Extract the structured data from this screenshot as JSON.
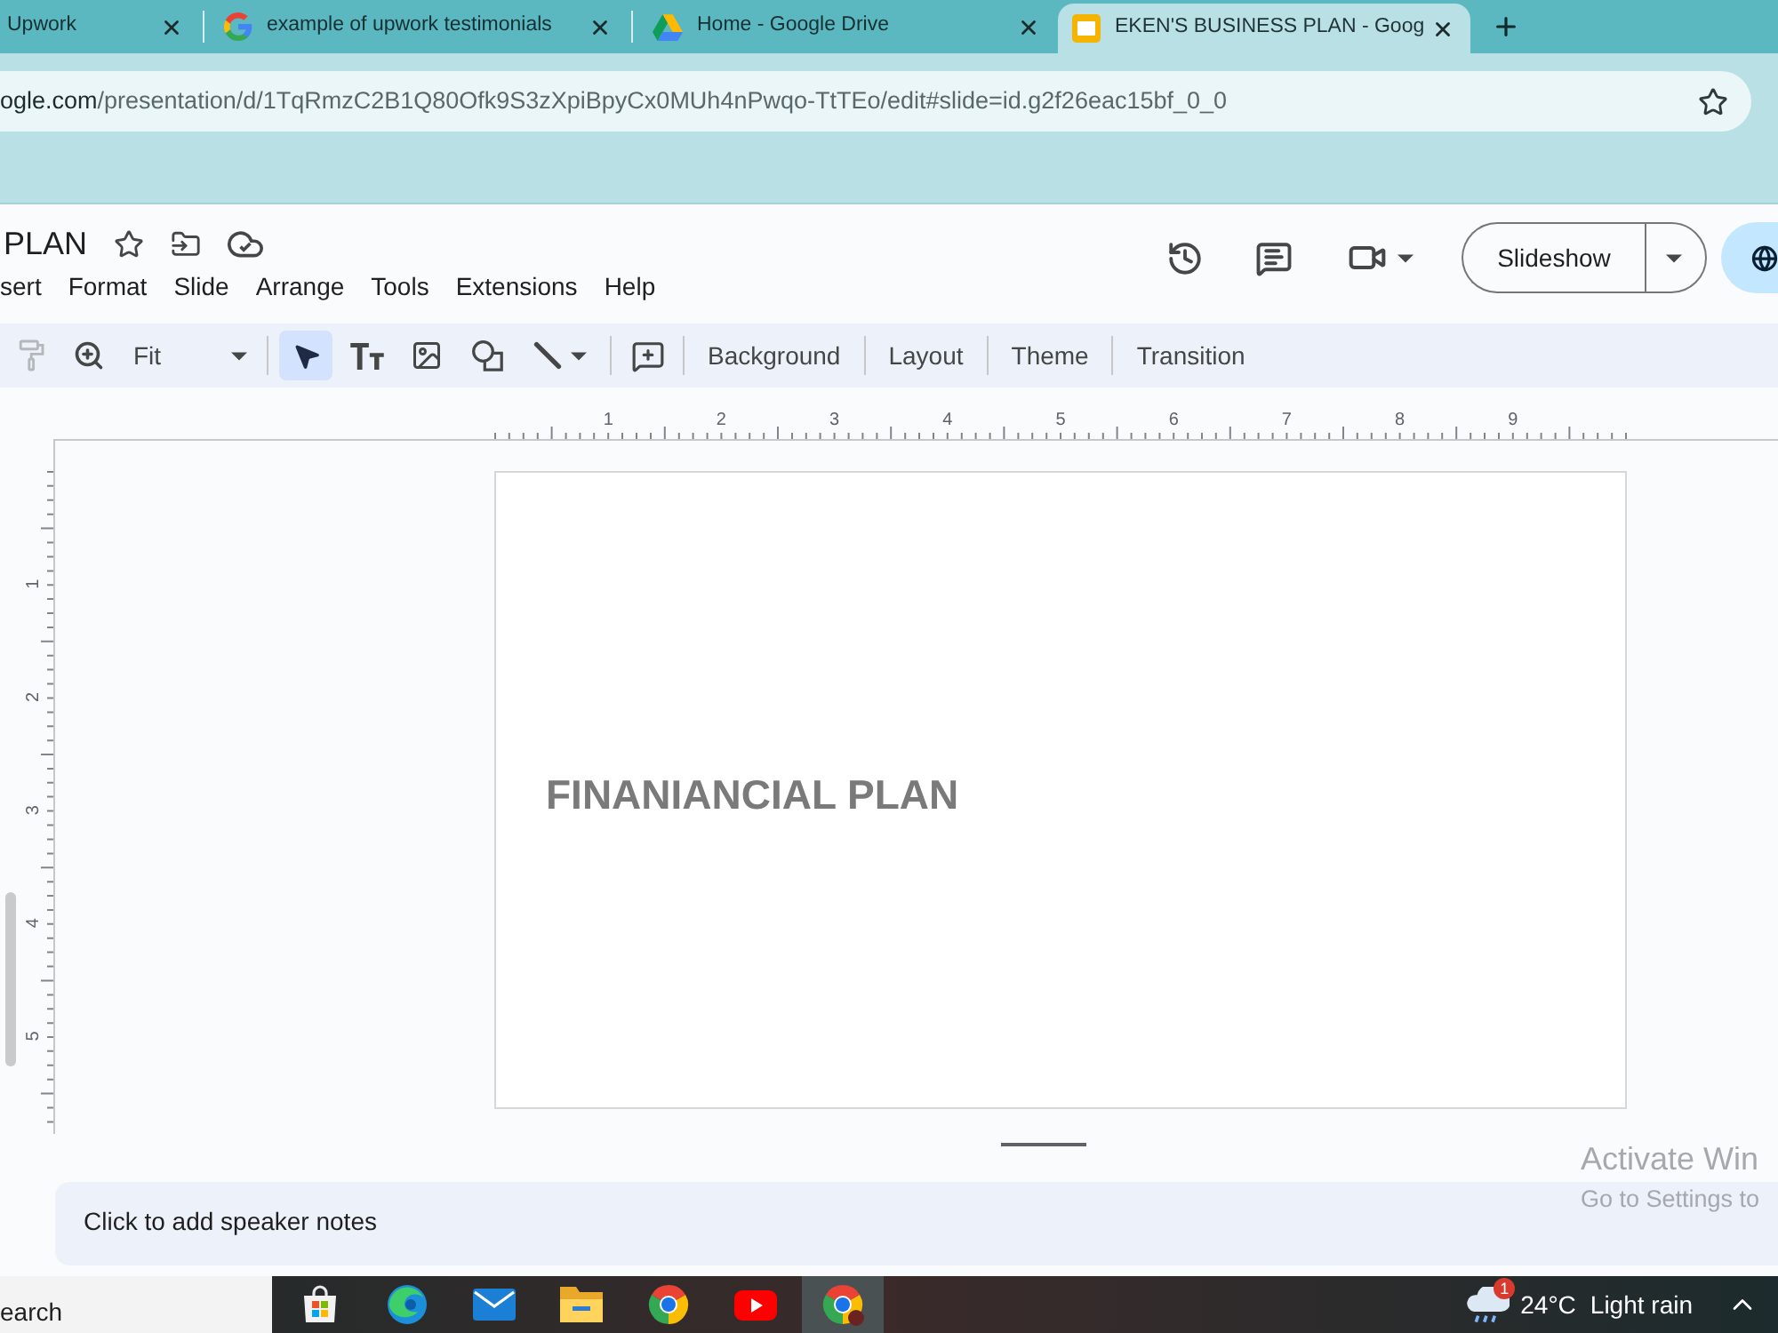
{
  "browser": {
    "tabs": [
      {
        "title": "Upwork",
        "kind": "plain",
        "selected": false
      },
      {
        "title": "example of upwork testimonials",
        "kind": "search",
        "selected": false
      },
      {
        "title": "Home - Google Drive",
        "kind": "drive",
        "selected": false
      },
      {
        "title": "EKEN'S BUSINESS PLAN - Goog",
        "kind": "slides",
        "selected": true
      }
    ],
    "address_bar": {
      "host": "ogle.com",
      "path": "/presentation/d/1TqRmzC2B1Q80Ofk9S3zXpiBpyCx0MUh4nPwqo-TtTEo/edit#slide=id.g2f26eac15bf_0_0"
    }
  },
  "slides_app": {
    "document_title": "PLAN",
    "menu": [
      "sert",
      "Format",
      "Slide",
      "Arrange",
      "Tools",
      "Extensions",
      "Help"
    ],
    "slideshow_button": "Slideshow",
    "toolbar": {
      "paint_format": {
        "disabled": true
      },
      "zoom": "Fit",
      "tools": [
        {
          "kind": "select",
          "selected": true
        },
        {
          "kind": "textbox",
          "selected": false
        },
        {
          "kind": "image",
          "selected": false
        },
        {
          "kind": "shape",
          "selected": false
        },
        {
          "kind": "line",
          "selected": false
        }
      ],
      "text_buttons": [
        "Background",
        "Layout",
        "Theme",
        "Transition"
      ]
    },
    "horizontal_ruler": [
      "1",
      "2",
      "3",
      "4",
      "5",
      "6",
      "7",
      "8",
      "9"
    ],
    "vertical_ruler": [
      "1",
      "2",
      "3",
      "4",
      "5"
    ],
    "slide": {
      "title": "FINANIANCIAL PLAN"
    },
    "speaker_notes": {
      "placeholder": "Click to add speaker notes"
    }
  },
  "activation_notice": {
    "title": "Activate Win",
    "subtitle": "Go to Settings to"
  },
  "taskbar": {
    "search": {
      "placeholder": "earch"
    },
    "apps": [
      {
        "kind": "store",
        "selected": false
      },
      {
        "kind": "edge",
        "selected": false
      },
      {
        "kind": "mail",
        "selected": false
      },
      {
        "kind": "explorer",
        "selected": false
      },
      {
        "kind": "chrome",
        "selected": false
      },
      {
        "kind": "youtube",
        "selected": false
      },
      {
        "kind": "chrome-profile",
        "selected": true
      }
    ],
    "weather": {
      "badge": "1",
      "temperature": "24°C",
      "condition": "Light rain"
    }
  }
}
